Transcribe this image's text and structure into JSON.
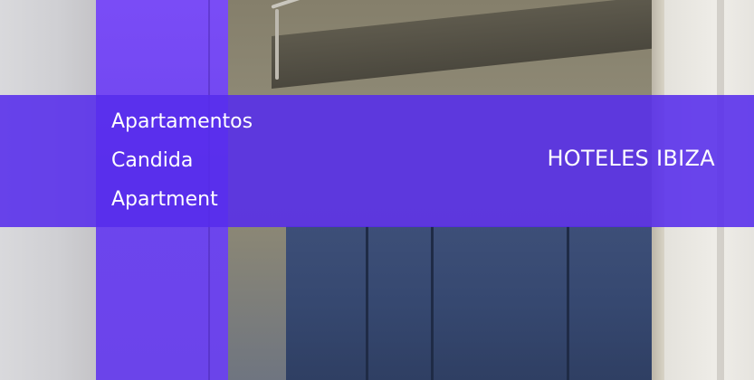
{
  "banner": {
    "title_lines": [
      "Apartamentos",
      "Candida",
      "Apartment"
    ],
    "category": "HOTELES IBIZA"
  },
  "colors": {
    "banner_overlay": "#562CEC",
    "banner_text": "#FFFFFF"
  }
}
